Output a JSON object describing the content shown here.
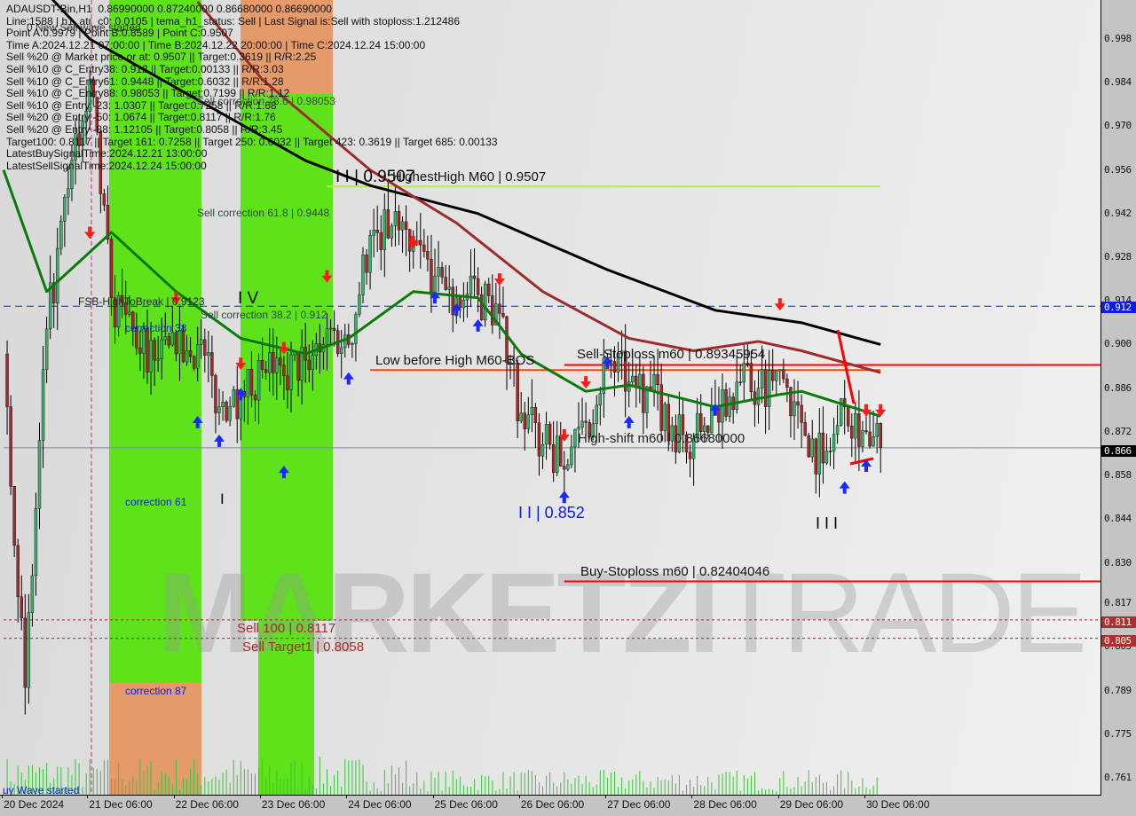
{
  "info_panel": {
    "lines": [
      "ADAUSDT-Bin,H1  0.86990000 0.87240000 0.86680000 0.86690000",
      "Line:1588 | h1_atr_c0: 0.0105 | tema_h1_status: Sell | Last Signal is:Sell with stoploss:1.212486",
      "Point A:0.9979 | Point B:0.8589 | Point C:0.9507",
      "Time A:2024.12.21 07:00:00 | Time B:2024.12.22 20:00:00 | Time C:2024.12.24 15:00:00",
      "Sell %20 @ Market price or at: 0.9507 || Target:0.3619 || R/R:2.25",
      "Sell %10 @ C_Entry38: 0.912 || Target:0.00133 || R/R:3.03",
      "Sell %10 @ C_Entry61: 0.9448 || Target:0.6032 || R/R:1.28",
      "Sell %10 @ C_Entry88: 0.98053 || Target:0.7199 || R/R:1.12",
      "Sell %10 @ Entry -23: 1.0307 || Target:0.7258 || R/R:1.68",
      "Sell %20 @ Entry -50: 1.0674 || Target:0.8117 || R/R:1.76",
      "Sell %20 @ Entry -88: 1.12105 || Target:0.8058 || R/R:3.45",
      "Target100: 0.8117 || Target 161: 0.7258 || Target 250: 0.6032 || Target 423: 0.3619 || Target 685: 0.00133",
      "LatestBuySignalTime:2024.12.21 13:00:00",
      "LatestSellSignalTime:2024.12.24 15:00:00"
    ]
  },
  "labels": {
    "new_sell_wave": "0 New Sell wave started",
    "sell_corr_786": "Sell correction 78.6 | 0.98053",
    "sell_corr_618": "Sell correction 61.8 | 0.9448",
    "sell_corr_382": "Sell correction 38.2 | 0.912",
    "fsb": "FSB-HighToBreak | 0.9123",
    "corr38": "correction 38",
    "corr61": "correction 61",
    "corr87": "correction 87",
    "wave_ii_top": "I I | 0.9507",
    "highest_high": "HighestHigh   M60 | 0.9507",
    "wave_iv": "I V",
    "wave_i": "I",
    "low_before_high": "Low before High   M60-BOS",
    "sell_stoploss": "Sell-Stoploss m60 | 0.89345954",
    "high_shift": "High-shift m60 | 0.86680000",
    "wave_ii_low": "I I | 0.852",
    "wave_iii": "I I I",
    "buy_stoploss": "Buy-Stoploss m60 | 0.82404046",
    "sell_100": "Sell 100 | 0.8117",
    "sell_target1": "Sell Target1 | 0.8058",
    "wave_started": "uy Wave started",
    "watermark_1": "MARKETZI",
    "watermark_2": "TRADE"
  },
  "price_axis": {
    "ticks": [
      "0.998",
      "0.984",
      "0.970",
      "0.956",
      "0.942",
      "0.928",
      "0.914",
      "0.900",
      "0.886",
      "0.872",
      "0.858",
      "0.844",
      "0.830",
      "0.817",
      "0.803",
      "0.789",
      "0.775",
      "0.761"
    ],
    "tags": [
      {
        "value": "0.912",
        "color": "#0a1ee6"
      },
      {
        "value": "0.866",
        "color": "#000000"
      },
      {
        "value": "0.811",
        "color": "#b03030"
      },
      {
        "value": "0.805",
        "color": "#b03030"
      }
    ]
  },
  "time_axis": {
    "ticks": [
      "20 Dec 2024",
      "21 Dec 06:00",
      "22 Dec 06:00",
      "23 Dec 06:00",
      "24 Dec 06:00",
      "25 Dec 06:00",
      "26 Dec 06:00",
      "27 Dec 06:00",
      "28 Dec 06:00",
      "29 Dec 06:00",
      "30 Dec 06:00"
    ]
  },
  "colors": {
    "bull": "#33b36b",
    "bear": "#a52a2a",
    "ma_black": "#000000",
    "ma_brown": "#9b2d2d",
    "ma_green": "#0a7a0a",
    "zone_green": "#5ee31a",
    "zone_orange": "#e59a6a",
    "level_blue": "#0a1ee6",
    "level_red": "#ff0000",
    "level_orange": "#ff4500",
    "highest_high": "#b6f03c"
  },
  "chart_data": {
    "type": "candlestick",
    "symbol": "ADAUSDT-Bin",
    "timeframe": "H1",
    "ylim": [
      0.755,
      1.01
    ],
    "grid": false,
    "closes": [
      {
        "t": "20 Dec 06:00",
        "c": 0.897
      },
      {
        "t": "20 Dec 12:00",
        "c": 0.79
      },
      {
        "t": "20 Dec 18:00",
        "c": 0.905
      },
      {
        "t": "21 Dec 00:00",
        "c": 0.95
      },
      {
        "t": "21 Dec 06:00",
        "c": 0.985
      },
      {
        "t": "21 Dec 12:00",
        "c": 0.915
      },
      {
        "t": "21 Dec 18:00",
        "c": 0.905
      },
      {
        "t": "22 Dec 00:00",
        "c": 0.895
      },
      {
        "t": "22 Dec 06:00",
        "c": 0.897
      },
      {
        "t": "22 Dec 12:00",
        "c": 0.9
      },
      {
        "t": "22 Dec 18:00",
        "c": 0.88
      },
      {
        "t": "23 Dec 00:00",
        "c": 0.885
      },
      {
        "t": "23 Dec 06:00",
        "c": 0.892
      },
      {
        "t": "23 Dec 12:00",
        "c": 0.89
      },
      {
        "t": "23 Dec 18:00",
        "c": 0.895
      },
      {
        "t": "24 Dec 00:00",
        "c": 0.905
      },
      {
        "t": "24 Dec 06:00",
        "c": 0.9
      },
      {
        "t": "24 Dec 12:00",
        "c": 0.935
      },
      {
        "t": "24 Dec 18:00",
        "c": 0.938
      },
      {
        "t": "25 Dec 00:00",
        "c": 0.932
      },
      {
        "t": "25 Dec 06:00",
        "c": 0.922
      },
      {
        "t": "25 Dec 12:00",
        "c": 0.915
      },
      {
        "t": "25 Dec 18:00",
        "c": 0.916
      },
      {
        "t": "26 Dec 00:00",
        "c": 0.91
      },
      {
        "t": "26 Dec 06:00",
        "c": 0.878
      },
      {
        "t": "26 Dec 12:00",
        "c": 0.868
      },
      {
        "t": "26 Dec 18:00",
        "c": 0.86
      },
      {
        "t": "27 Dec 00:00",
        "c": 0.875
      },
      {
        "t": "27 Dec 06:00",
        "c": 0.895
      },
      {
        "t": "27 Dec 12:00",
        "c": 0.888
      },
      {
        "t": "27 Dec 18:00",
        "c": 0.885
      },
      {
        "t": "28 Dec 00:00",
        "c": 0.874
      },
      {
        "t": "28 Dec 06:00",
        "c": 0.87
      },
      {
        "t": "28 Dec 12:00",
        "c": 0.88
      },
      {
        "t": "28 Dec 18:00",
        "c": 0.888
      },
      {
        "t": "29 Dec 00:00",
        "c": 0.886
      },
      {
        "t": "29 Dec 06:00",
        "c": 0.892
      },
      {
        "t": "29 Dec 12:00",
        "c": 0.875
      },
      {
        "t": "29 Dec 18:00",
        "c": 0.862
      },
      {
        "t": "30 Dec 00:00",
        "c": 0.88
      },
      {
        "t": "30 Dec 06:00",
        "c": 0.872
      },
      {
        "t": "30 Dec 10:00",
        "c": 0.8669
      }
    ],
    "last_bar": {
      "open": 0.8699,
      "high": 0.8724,
      "low": 0.8668,
      "close": 0.8669
    },
    "moving_averages": [
      {
        "color_key": "ma_black",
        "points": [
          {
            "t": "20 Dec 12:00",
            "v": 1.02
          },
          {
            "t": "21 Dec 06:00",
            "v": 0.998
          },
          {
            "t": "23 Dec 18:00",
            "v": 0.959
          },
          {
            "t": "24 Dec 12:00",
            "v": 0.951
          },
          {
            "t": "25 Dec 18:00",
            "v": 0.942
          },
          {
            "t": "27 Dec 06:00",
            "v": 0.924
          },
          {
            "t": "28 Dec 12:00",
            "v": 0.911
          },
          {
            "t": "29 Dec 12:00",
            "v": 0.907
          },
          {
            "t": "30 Dec 10:00",
            "v": 0.9
          }
        ]
      },
      {
        "color_key": "ma_brown",
        "points": [
          {
            "t": "22 Dec 12:00",
            "v": 1.01
          },
          {
            "t": "23 Dec 06:00",
            "v": 0.985
          },
          {
            "t": "24 Dec 12:00",
            "v": 0.956
          },
          {
            "t": "25 Dec 12:00",
            "v": 0.939
          },
          {
            "t": "26 Dec 12:00",
            "v": 0.917
          },
          {
            "t": "27 Dec 12:00",
            "v": 0.902
          },
          {
            "t": "28 Dec 06:00",
            "v": 0.898
          },
          {
            "t": "29 Dec 00:00",
            "v": 0.901
          },
          {
            "t": "29 Dec 12:00",
            "v": 0.898
          },
          {
            "t": "30 Dec 10:00",
            "v": 0.891
          }
        ]
      },
      {
        "color_key": "ma_green",
        "points": [
          {
            "t": "20 Dec 06:00",
            "v": 0.956
          },
          {
            "t": "20 Dec 18:00",
            "v": 0.917
          },
          {
            "t": "21 Dec 12:00",
            "v": 0.936
          },
          {
            "t": "22 Dec 06:00",
            "v": 0.917
          },
          {
            "t": "23 Dec 00:00",
            "v": 0.902
          },
          {
            "t": "23 Dec 18:00",
            "v": 0.897
          },
          {
            "t": "24 Dec 06:00",
            "v": 0.902
          },
          {
            "t": "25 Dec 00:00",
            "v": 0.917
          },
          {
            "t": "25 Dec 18:00",
            "v": 0.915
          },
          {
            "t": "26 Dec 06:00",
            "v": 0.897
          },
          {
            "t": "27 Dec 00:00",
            "v": 0.885
          },
          {
            "t": "27 Dec 12:00",
            "v": 0.887
          },
          {
            "t": "28 Dec 12:00",
            "v": 0.88
          },
          {
            "t": "29 Dec 06:00",
            "v": 0.884
          },
          {
            "t": "29 Dec 12:00",
            "v": 0.885
          },
          {
            "t": "30 Dec 10:00",
            "v": 0.877
          }
        ]
      }
    ],
    "levels": [
      {
        "name": "fsb-high-to-break",
        "price": 0.9123,
        "style": "dashed",
        "color_key": "level_blue",
        "from": "20 Dec 06:00",
        "to": "end"
      },
      {
        "name": "highest-high",
        "price": 0.9507,
        "style": "solid",
        "color_key": "highest_high",
        "from": "24 Dec 00:00",
        "to": "30 Dec 10:00"
      },
      {
        "name": "sell-stoploss",
        "price": 0.89345954,
        "style": "solid",
        "color_key": "level_red",
        "from": "26 Dec 18:00",
        "to": "end"
      },
      {
        "name": "low-before-high",
        "price": 0.8918,
        "style": "solid",
        "color_key": "level_orange",
        "from": "24 Dec 12:00",
        "to": "30 Dec 10:00"
      },
      {
        "name": "buy-stoploss",
        "price": 0.82404046,
        "style": "solid",
        "color_key": "level_red",
        "from": "26 Dec 18:00",
        "to": "end"
      },
      {
        "name": "sell-100",
        "price": 0.8117,
        "style": "dotted",
        "color_key": "bear",
        "from": "20 Dec 06:00",
        "to": "end"
      },
      {
        "name": "sell-target1",
        "price": 0.8058,
        "style": "dotted",
        "color_key": "bear",
        "from": "20 Dec 06:00",
        "to": "end"
      },
      {
        "name": "current-price",
        "price": 0.8669,
        "style": "solid",
        "color_key": "current",
        "from": "20 Dec 06:00",
        "to": "end"
      }
    ],
    "signals": [
      {
        "t": "21 Dec 06:00",
        "p": 0.935,
        "dir": "sell"
      },
      {
        "t": "22 Dec 06:00",
        "p": 0.914,
        "dir": "sell"
      },
      {
        "t": "22 Dec 12:00",
        "p": 0.876,
        "dir": "buy"
      },
      {
        "t": "22 Dec 18:00",
        "p": 0.87,
        "dir": "buy"
      },
      {
        "t": "23 Dec 00:00",
        "p": 0.885,
        "dir": "buy"
      },
      {
        "t": "23 Dec 00:00",
        "p": 0.893,
        "dir": "sell"
      },
      {
        "t": "23 Dec 12:00",
        "p": 0.86,
        "dir": "buy"
      },
      {
        "t": "23 Dec 12:00",
        "p": 0.898,
        "dir": "sell"
      },
      {
        "t": "24 Dec 00:00",
        "p": 0.921,
        "dir": "sell"
      },
      {
        "t": "24 Dec 06:00",
        "p": 0.89,
        "dir": "buy"
      },
      {
        "t": "25 Dec 00:00",
        "p": 0.932,
        "dir": "sell"
      },
      {
        "t": "25 Dec 06:00",
        "p": 0.916,
        "dir": "buy"
      },
      {
        "t": "25 Dec 12:00",
        "p": 0.912,
        "dir": "buy"
      },
      {
        "t": "25 Dec 18:00",
        "p": 0.907,
        "dir": "buy"
      },
      {
        "t": "26 Dec 00:00",
        "p": 0.92,
        "dir": "sell"
      },
      {
        "t": "26 Dec 18:00",
        "p": 0.852,
        "dir": "buy"
      },
      {
        "t": "26 Dec 18:00",
        "p": 0.87,
        "dir": "sell"
      },
      {
        "t": "27 Dec 00:00",
        "p": 0.887,
        "dir": "sell"
      },
      {
        "t": "27 Dec 06:00",
        "p": 0.895,
        "dir": "buy"
      },
      {
        "t": "27 Dec 12:00",
        "p": 0.876,
        "dir": "buy"
      },
      {
        "t": "28 Dec 12:00",
        "p": 0.88,
        "dir": "buy"
      },
      {
        "t": "29 Dec 06:00",
        "p": 0.912,
        "dir": "sell"
      },
      {
        "t": "30 Dec 00:00",
        "p": 0.855,
        "dir": "buy"
      },
      {
        "t": "30 Dec 06:00",
        "p": 0.862,
        "dir": "buy"
      },
      {
        "t": "30 Dec 06:00",
        "p": 0.878,
        "dir": "sell"
      },
      {
        "t": "30 Dec 10:00",
        "p": 0.878,
        "dir": "sell"
      }
    ]
  }
}
